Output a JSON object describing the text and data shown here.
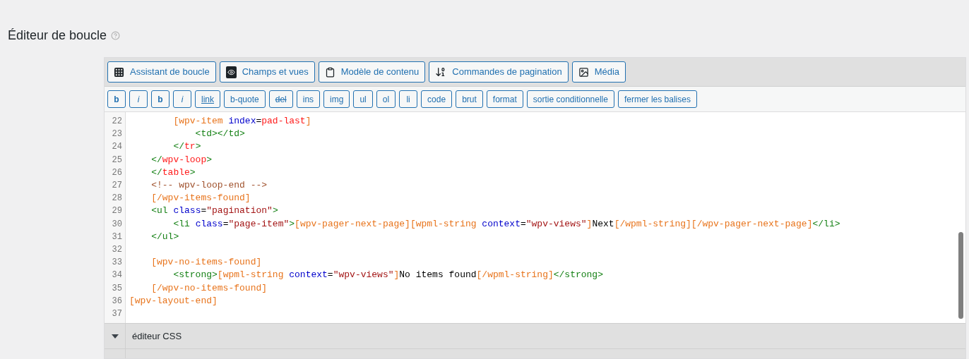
{
  "title": "Éditeur de boucle",
  "toolbar": [
    {
      "label": "Assistant de boucle"
    },
    {
      "label": "Champs et vues"
    },
    {
      "label": "Modèle de contenu"
    },
    {
      "label": "Commandes de pagination"
    },
    {
      "label": "Média"
    }
  ],
  "tag_buttons": [
    {
      "label": "b",
      "kind": "bold"
    },
    {
      "label": "i",
      "kind": "italic"
    },
    {
      "label": "b",
      "kind": "bold"
    },
    {
      "label": "i",
      "kind": "italic"
    },
    {
      "label": "link",
      "kind": "link"
    },
    {
      "label": "b-quote",
      "kind": "plain"
    },
    {
      "label": "del",
      "kind": "strike"
    },
    {
      "label": "ins",
      "kind": "plain"
    },
    {
      "label": "img",
      "kind": "plain"
    },
    {
      "label": "ul",
      "kind": "plain"
    },
    {
      "label": "ol",
      "kind": "plain"
    },
    {
      "label": "li",
      "kind": "plain"
    },
    {
      "label": "code",
      "kind": "plain"
    },
    {
      "label": "brut",
      "kind": "plain"
    },
    {
      "label": "format",
      "kind": "plain"
    },
    {
      "label": "sortie conditionnelle",
      "kind": "plain"
    },
    {
      "label": "fermer les balises",
      "kind": "plain"
    }
  ],
  "code_lines": [
    {
      "number": "22",
      "tokens": [
        {
          "kind": "shortcode",
          "text": "        [wpv-item "
        },
        {
          "kind": "attr",
          "text": "index"
        },
        {
          "kind": "text",
          "text": "="
        },
        {
          "kind": "error",
          "text": "pad-last"
        },
        {
          "kind": "shortcode",
          "text": "]"
        }
      ]
    },
    {
      "number": "23",
      "tokens": [
        {
          "kind": "tag",
          "text": "            <td></td>"
        }
      ]
    },
    {
      "number": "24",
      "tokens": [
        {
          "kind": "tag",
          "text": "        </"
        },
        {
          "kind": "error",
          "text": "tr"
        },
        {
          "kind": "tag",
          "text": ">"
        }
      ]
    },
    {
      "number": "25",
      "tokens": [
        {
          "kind": "tag",
          "text": "    </"
        },
        {
          "kind": "error",
          "text": "wpv-loop"
        },
        {
          "kind": "tag",
          "text": ">"
        }
      ]
    },
    {
      "number": "26",
      "tokens": [
        {
          "kind": "tag",
          "text": "    </"
        },
        {
          "kind": "error",
          "text": "table"
        },
        {
          "kind": "tag",
          "text": ">"
        }
      ]
    },
    {
      "number": "27",
      "tokens": [
        {
          "kind": "comment",
          "text": "    <!-- wpv-loop-end -->"
        }
      ]
    },
    {
      "number": "28",
      "tokens": [
        {
          "kind": "shortcode",
          "text": "    [/wpv-items-found]"
        }
      ]
    },
    {
      "number": "29",
      "tokens": [
        {
          "kind": "tag",
          "text": "    <ul "
        },
        {
          "kind": "attr",
          "text": "class"
        },
        {
          "kind": "text",
          "text": "="
        },
        {
          "kind": "string",
          "text": "\"pagination\""
        },
        {
          "kind": "tag",
          "text": ">"
        }
      ]
    },
    {
      "number": "30",
      "tokens": [
        {
          "kind": "tag",
          "text": "        <li "
        },
        {
          "kind": "attr",
          "text": "class"
        },
        {
          "kind": "text",
          "text": "="
        },
        {
          "kind": "string",
          "text": "\"page-item\""
        },
        {
          "kind": "tag",
          "text": ">"
        },
        {
          "kind": "shortcode",
          "text": "[wpv-pager-next-page][wpml-string "
        },
        {
          "kind": "attr",
          "text": "context"
        },
        {
          "kind": "text",
          "text": "="
        },
        {
          "kind": "string",
          "text": "\"wpv-views\""
        },
        {
          "kind": "shortcode",
          "text": "]"
        },
        {
          "kind": "text",
          "text": "Next"
        },
        {
          "kind": "shortcode",
          "text": "[/wpml-string][/wpv-pager-next-page]"
        },
        {
          "kind": "tag",
          "text": "</li>"
        }
      ]
    },
    {
      "number": "31",
      "tokens": [
        {
          "kind": "tag",
          "text": "    </ul>"
        }
      ]
    },
    {
      "number": "32"
    },
    {
      "number": "33",
      "tokens": [
        {
          "kind": "shortcode",
          "text": "    [wpv-no-items-found]"
        }
      ]
    },
    {
      "number": "34",
      "tokens": [
        {
          "kind": "tag",
          "text": "        <strong>"
        },
        {
          "kind": "shortcode",
          "text": "[wpml-string "
        },
        {
          "kind": "attr",
          "text": "context"
        },
        {
          "kind": "text",
          "text": "="
        },
        {
          "kind": "string",
          "text": "\"wpv-views\""
        },
        {
          "kind": "shortcode",
          "text": "]"
        },
        {
          "kind": "text",
          "text": "No items found"
        },
        {
          "kind": "shortcode",
          "text": "[/wpml-string]"
        },
        {
          "kind": "tag",
          "text": "</strong>"
        }
      ]
    },
    {
      "number": "35",
      "tokens": [
        {
          "kind": "shortcode",
          "text": "    [/wpv-no-items-found]"
        }
      ]
    },
    {
      "number": "36",
      "tokens": [
        {
          "kind": "shortcode",
          "text": "[wpv-layout-end]"
        }
      ]
    },
    {
      "number": "37"
    }
  ],
  "sections": [
    {
      "label": "éditeur CSS",
      "expanded": false
    }
  ]
}
